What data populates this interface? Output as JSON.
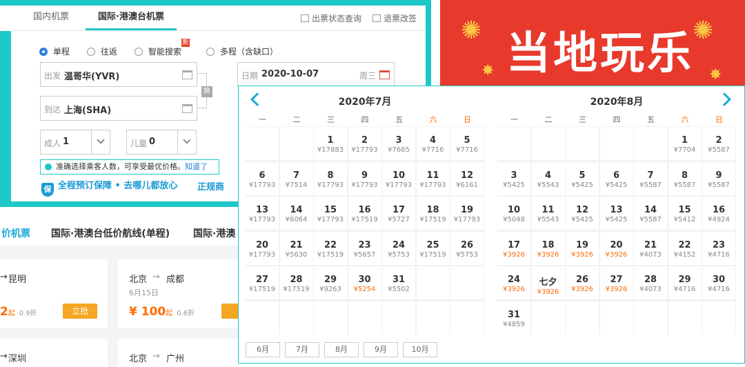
{
  "tabs": {
    "domestic": "国内机票",
    "intl": "国际·港澳台机票"
  },
  "toplinks": {
    "status": "出票状态查询",
    "refund": "退票改签"
  },
  "trip_types": {
    "oneway": "单程",
    "round": "往返",
    "smart": "智能搜索",
    "multi": "多程（含缺口）",
    "new_badge": "新"
  },
  "form": {
    "from_label": "出发",
    "from_value": "温哥华(YVR)",
    "to_label": "到达",
    "to_value": "上海(SHA)",
    "swap": "换",
    "date_label": "日期",
    "date_value": "2020-10-07",
    "date_weekday": "周三",
    "adult_label": "成人",
    "adult_value": "1",
    "child_label": "儿童",
    "child_value": "0"
  },
  "tip": {
    "text": "准确选择乘客人数，可享受最优价格。",
    "ok": "知道了"
  },
  "guarantee": {
    "shield": "保",
    "text": "全程预订保障 • 去哪儿都放心",
    "text2": "正规商"
  },
  "lower_tabs": [
    "价机票",
    "国际·港澳台低价航线(单程)",
    "国际·港澳"
  ],
  "cards": [
    {
      "route_from": "",
      "route_to": "昆明",
      "date": "",
      "price": "2",
      "unit": "起",
      "disc": "0.9折",
      "buy": ""
    },
    {
      "route_from": "北京",
      "route_to": "成都",
      "date": "6月15日",
      "price": "¥ 100",
      "unit": "起",
      "disc": "0.6折",
      "buy": "立抢"
    },
    {
      "route_from": "",
      "route_to": "深圳"
    },
    {
      "route_from": "北京",
      "route_to": "广州"
    }
  ],
  "buy_label_1": "立抢",
  "banner": {
    "text": "当地玩乐"
  },
  "calendar": {
    "weekdays": [
      "一",
      "二",
      "三",
      "四",
      "五",
      "六",
      "日"
    ],
    "left": {
      "title": "2020年7月",
      "days": [
        {
          "c": 2,
          "r": 0,
          "d": "1",
          "p": "¥17883"
        },
        {
          "c": 3,
          "r": 0,
          "d": "2",
          "p": "¥17793"
        },
        {
          "c": 4,
          "r": 0,
          "d": "3",
          "p": "¥7665"
        },
        {
          "c": 5,
          "r": 0,
          "d": "4",
          "p": "¥7716"
        },
        {
          "c": 6,
          "r": 0,
          "d": "5",
          "p": "¥7716"
        },
        {
          "c": 0,
          "r": 1,
          "d": "6",
          "p": "¥17793"
        },
        {
          "c": 1,
          "r": 1,
          "d": "7",
          "p": "¥7514"
        },
        {
          "c": 2,
          "r": 1,
          "d": "8",
          "p": "¥17793"
        },
        {
          "c": 3,
          "r": 1,
          "d": "9",
          "p": "¥17793"
        },
        {
          "c": 4,
          "r": 1,
          "d": "10",
          "p": "¥17793"
        },
        {
          "c": 5,
          "r": 1,
          "d": "11",
          "p": "¥17793"
        },
        {
          "c": 6,
          "r": 1,
          "d": "12",
          "p": "¥6161"
        },
        {
          "c": 0,
          "r": 2,
          "d": "13",
          "p": "¥17793"
        },
        {
          "c": 1,
          "r": 2,
          "d": "14",
          "p": "¥6064"
        },
        {
          "c": 2,
          "r": 2,
          "d": "15",
          "p": "¥17793"
        },
        {
          "c": 3,
          "r": 2,
          "d": "16",
          "p": "¥17519"
        },
        {
          "c": 4,
          "r": 2,
          "d": "17",
          "p": "¥5727"
        },
        {
          "c": 5,
          "r": 2,
          "d": "18",
          "p": "¥17519"
        },
        {
          "c": 6,
          "r": 2,
          "d": "19",
          "p": "¥17793"
        },
        {
          "c": 0,
          "r": 3,
          "d": "20",
          "p": "¥17793"
        },
        {
          "c": 1,
          "r": 3,
          "d": "21",
          "p": "¥5630"
        },
        {
          "c": 2,
          "r": 3,
          "d": "22",
          "p": "¥17519"
        },
        {
          "c": 3,
          "r": 3,
          "d": "23",
          "p": "¥5657"
        },
        {
          "c": 4,
          "r": 3,
          "d": "24",
          "p": "¥5753"
        },
        {
          "c": 5,
          "r": 3,
          "d": "25",
          "p": "¥17519"
        },
        {
          "c": 6,
          "r": 3,
          "d": "26",
          "p": "¥5753"
        },
        {
          "c": 0,
          "r": 4,
          "d": "27",
          "p": "¥17519"
        },
        {
          "c": 1,
          "r": 4,
          "d": "28",
          "p": "¥17519"
        },
        {
          "c": 2,
          "r": 4,
          "d": "29",
          "p": "¥9263"
        },
        {
          "c": 3,
          "r": 4,
          "d": "30",
          "p": "¥5254",
          "low": true
        },
        {
          "c": 4,
          "r": 4,
          "d": "31",
          "p": "¥5502"
        }
      ]
    },
    "right": {
      "title": "2020年8月",
      "days": [
        {
          "c": 5,
          "r": 0,
          "d": "1",
          "p": "¥7704"
        },
        {
          "c": 6,
          "r": 0,
          "d": "2",
          "p": "¥5587"
        },
        {
          "c": 0,
          "r": 1,
          "d": "3",
          "p": "¥5425"
        },
        {
          "c": 1,
          "r": 1,
          "d": "4",
          "p": "¥5543"
        },
        {
          "c": 2,
          "r": 1,
          "d": "5",
          "p": "¥5425"
        },
        {
          "c": 3,
          "r": 1,
          "d": "6",
          "p": "¥5425"
        },
        {
          "c": 4,
          "r": 1,
          "d": "7",
          "p": "¥5587"
        },
        {
          "c": 5,
          "r": 1,
          "d": "8",
          "p": "¥5587"
        },
        {
          "c": 6,
          "r": 1,
          "d": "9",
          "p": "¥5587"
        },
        {
          "c": 0,
          "r": 2,
          "d": "10",
          "p": "¥5048"
        },
        {
          "c": 1,
          "r": 2,
          "d": "11",
          "p": "¥5543"
        },
        {
          "c": 2,
          "r": 2,
          "d": "12",
          "p": "¥5425"
        },
        {
          "c": 3,
          "r": 2,
          "d": "13",
          "p": "¥5425"
        },
        {
          "c": 4,
          "r": 2,
          "d": "14",
          "p": "¥5587"
        },
        {
          "c": 5,
          "r": 2,
          "d": "15",
          "p": "¥5412"
        },
        {
          "c": 6,
          "r": 2,
          "d": "16",
          "p": "¥4924"
        },
        {
          "c": 0,
          "r": 3,
          "d": "17",
          "p": "¥3926",
          "low": true
        },
        {
          "c": 1,
          "r": 3,
          "d": "18",
          "p": "¥3926",
          "low": true
        },
        {
          "c": 2,
          "r": 3,
          "d": "19",
          "p": "¥3926",
          "low": true
        },
        {
          "c": 3,
          "r": 3,
          "d": "20",
          "p": "¥3926",
          "low": true
        },
        {
          "c": 4,
          "r": 3,
          "d": "21",
          "p": "¥4073"
        },
        {
          "c": 5,
          "r": 3,
          "d": "22",
          "p": "¥4152"
        },
        {
          "c": 6,
          "r": 3,
          "d": "23",
          "p": "¥4716"
        },
        {
          "c": 0,
          "r": 4,
          "d": "24",
          "p": "¥3926",
          "low": true
        },
        {
          "c": 1,
          "r": 4,
          "d": "七夕",
          "p": "¥3926",
          "low": true
        },
        {
          "c": 2,
          "r": 4,
          "d": "26",
          "p": "¥3926",
          "low": true
        },
        {
          "c": 3,
          "r": 4,
          "d": "27",
          "p": "¥3926",
          "low": true
        },
        {
          "c": 4,
          "r": 4,
          "d": "28",
          "p": "¥4073"
        },
        {
          "c": 5,
          "r": 4,
          "d": "29",
          "p": "¥4716"
        },
        {
          "c": 6,
          "r": 4,
          "d": "30",
          "p": "¥4716"
        },
        {
          "c": 0,
          "r": 5,
          "d": "31",
          "p": "¥4859"
        }
      ]
    },
    "months": [
      "6月",
      "7月",
      "8月",
      "9月",
      "10月"
    ]
  },
  "colors": {
    "accent": "#1ec8c8",
    "price_low": "#ff6a00",
    "banner": "#e8392d",
    "link": "#1aa8d8"
  }
}
